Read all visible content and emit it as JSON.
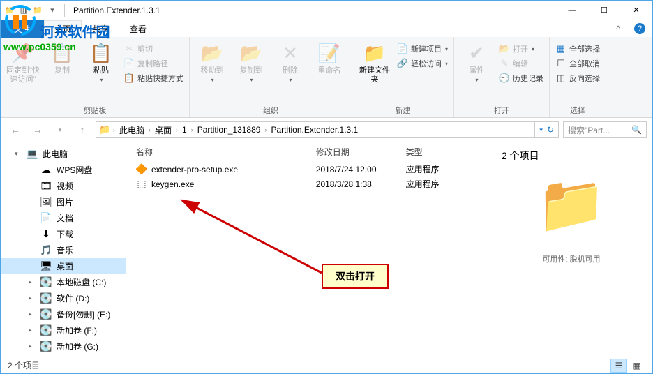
{
  "watermark": {
    "text": "河东软件园",
    "url": "www.pc0359.cn"
  },
  "titlebar": {
    "title": "Partition.Extender.1.3.1"
  },
  "tabs": {
    "file": "文件",
    "home": "主页",
    "share": "共享",
    "view": "查看"
  },
  "ribbon": {
    "pin": "固定到\"快速访问\"",
    "copy": "复制",
    "paste": "粘贴",
    "cut": "剪切",
    "copy_path": "复制路径",
    "paste_shortcut": "粘贴快捷方式",
    "clipboard_label": "剪贴板",
    "move_to": "移动到",
    "copy_to": "复制到",
    "delete": "删除",
    "rename": "重命名",
    "organize_label": "组织",
    "new_folder": "新建文件夹",
    "new_item": "新建项目",
    "easy_access": "轻松访问",
    "new_label": "新建",
    "properties": "属性",
    "open": "打开",
    "edit": "编辑",
    "history": "历史记录",
    "open_label": "打开",
    "select_all": "全部选择",
    "select_none": "全部取消",
    "invert_selection": "反向选择",
    "select_label": "选择"
  },
  "breadcrumb": {
    "parts": [
      "此电脑",
      "桌面",
      "1",
      "Partition_131889",
      "Partition.Extender.1.3.1"
    ]
  },
  "search": {
    "placeholder": "搜索\"Part..."
  },
  "sidebar": {
    "items": [
      {
        "icon": "💻",
        "label": "此电脑",
        "chev": "▾"
      },
      {
        "icon": "☁",
        "label": "WPS网盘",
        "sub": true
      },
      {
        "icon": "🎞",
        "label": "视频",
        "sub": true
      },
      {
        "icon": "🖼",
        "label": "图片",
        "sub": true
      },
      {
        "icon": "📄",
        "label": "文档",
        "sub": true
      },
      {
        "icon": "⬇",
        "label": "下载",
        "sub": true
      },
      {
        "icon": "🎵",
        "label": "音乐",
        "sub": true
      },
      {
        "icon": "🖥",
        "label": "桌面",
        "sub": true,
        "selected": true
      },
      {
        "icon": "💽",
        "label": "本地磁盘 (C:)",
        "sub": true,
        "chev": "▸"
      },
      {
        "icon": "💽",
        "label": "软件 (D:)",
        "sub": true,
        "chev": "▸"
      },
      {
        "icon": "💽",
        "label": "备份[勿删] (E:)",
        "sub": true,
        "chev": "▸"
      },
      {
        "icon": "💽",
        "label": "新加卷 (F:)",
        "sub": true,
        "chev": "▸"
      },
      {
        "icon": "💽",
        "label": "新加卷 (G:)",
        "sub": true,
        "chev": "▸"
      }
    ]
  },
  "filegrid": {
    "cols": {
      "name": "名称",
      "date": "修改日期",
      "type": "类型"
    },
    "rows": [
      {
        "icon": "🔶",
        "name": "extender-pro-setup.exe",
        "date": "2018/7/24 12:00",
        "type": "应用程序"
      },
      {
        "icon": "⬚",
        "name": "keygen.exe",
        "date": "2018/3/28 1:38",
        "type": "应用程序"
      }
    ]
  },
  "details": {
    "title": "2 个项目",
    "availability_label": "可用性:",
    "availability_value": "脱机可用"
  },
  "callout": {
    "text": "双击打开"
  },
  "statusbar": {
    "text": "2 个项目"
  }
}
